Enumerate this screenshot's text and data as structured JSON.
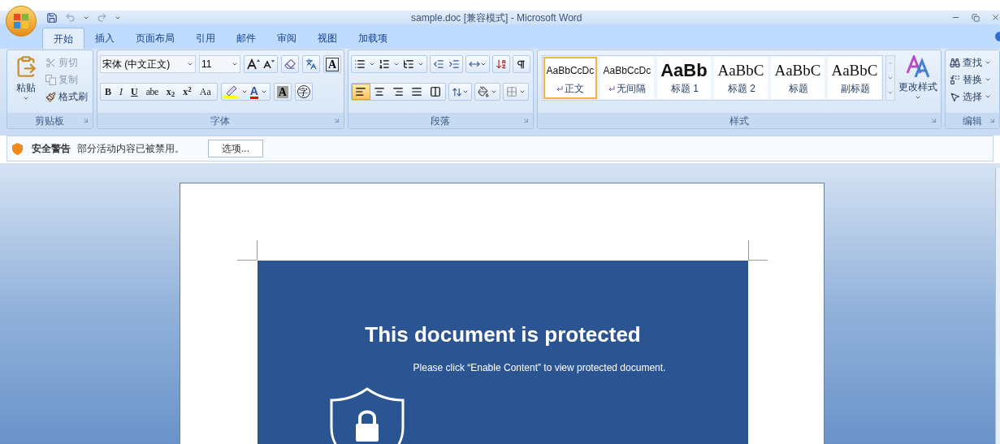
{
  "window": {
    "title": "sample.doc [兼容模式] - Microsoft Word"
  },
  "tabs": [
    {
      "label": "开始",
      "selected": true
    },
    {
      "label": "插入",
      "selected": false
    },
    {
      "label": "页面布局",
      "selected": false
    },
    {
      "label": "引用",
      "selected": false
    },
    {
      "label": "邮件",
      "selected": false
    },
    {
      "label": "审阅",
      "selected": false
    },
    {
      "label": "视图",
      "selected": false
    },
    {
      "label": "加载项",
      "selected": false
    }
  ],
  "clipboard": {
    "label": "剪贴板",
    "paste": "粘贴",
    "items": [
      {
        "kind": "cut",
        "label": "剪切",
        "disabled": true
      },
      {
        "kind": "copy",
        "label": "复制",
        "disabled": true
      },
      {
        "kind": "painter",
        "label": "格式刷",
        "disabled": false
      }
    ]
  },
  "font": {
    "label": "字体",
    "font_name": "宋体 (中文正文)",
    "font_size": "11",
    "border_char": "A",
    "format_buttons": [
      {
        "text": "B",
        "kind": "bold"
      },
      {
        "text": "I",
        "kind": "italic"
      },
      {
        "text": "U",
        "kind": "underline"
      },
      {
        "text": "abe",
        "kind": "strike"
      },
      {
        "text": "x$_{2}$",
        "kind": "plain"
      },
      {
        "text": "x$^{2}$",
        "kind": "plain"
      },
      {
        "text": "Aa",
        "kind": "case"
      }
    ],
    "font_color_char": "A",
    "shading_char": "A",
    "enclosed_char": "字"
  },
  "paragraph": {
    "label": "段落",
    "alignments": [
      {
        "kind": "left",
        "selected": true
      },
      {
        "kind": "center",
        "selected": false
      },
      {
        "kind": "right",
        "selected": false
      },
      {
        "kind": "justify",
        "selected": false
      },
      {
        "kind": "distributed",
        "selected": false
      }
    ]
  },
  "styles": {
    "label": "样式",
    "change_styles": "更改样式",
    "items": [
      {
        "preview": "AaBbCcDc",
        "name": "正文",
        "kind": "normal",
        "selected": true
      },
      {
        "preview": "AaBbCcDc",
        "name": "无间隔",
        "kind": "normal",
        "selected": false
      },
      {
        "preview": "AaBb",
        "name": "标题 1",
        "kind": "heading1",
        "selected": false
      },
      {
        "preview": "AaBbC",
        "name": "标题 2",
        "kind": "heading2",
        "selected": false
      },
      {
        "preview": "AaBbC",
        "name": "标题",
        "kind": "heading2",
        "selected": false
      },
      {
        "preview": "AaBbC",
        "name": "副标题",
        "kind": "heading2",
        "selected": false
      }
    ]
  },
  "editing": {
    "label": "编辑",
    "items": [
      {
        "kind": "find",
        "label": "查找"
      },
      {
        "kind": "replace",
        "label": "替换"
      },
      {
        "kind": "select",
        "label": "选择"
      }
    ]
  },
  "security_bar": {
    "title": "安全警告",
    "message": "部分活动内容已被禁用。",
    "button": "选项..."
  },
  "document": {
    "heading": "This document is protected",
    "message": "Please click “Enable Content” to view protected document."
  }
}
